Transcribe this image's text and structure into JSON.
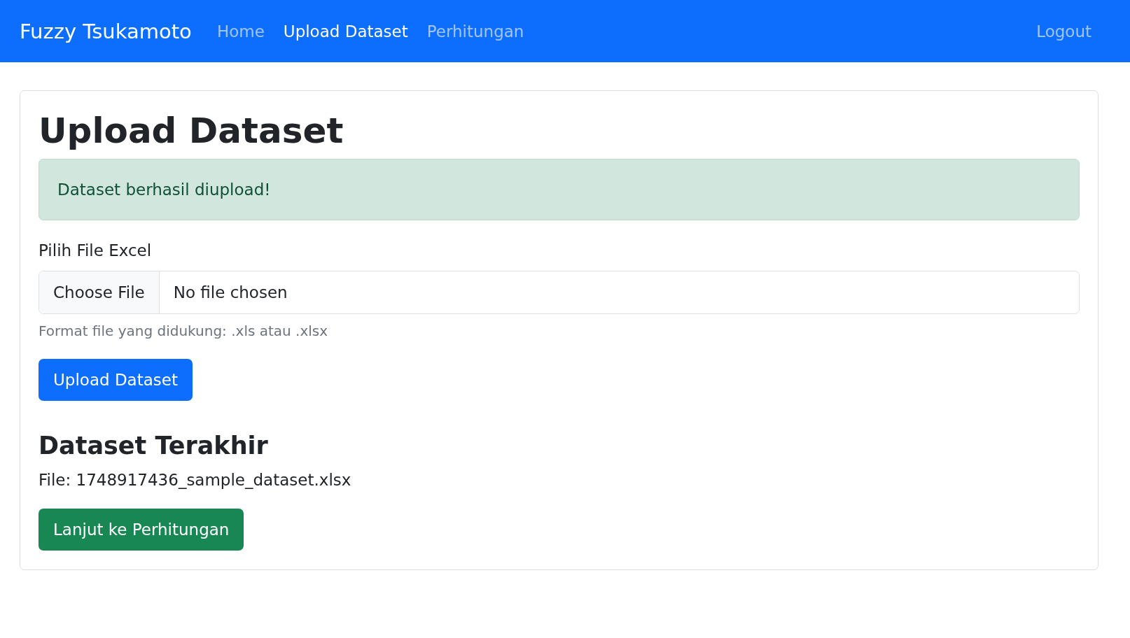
{
  "navbar": {
    "brand": "Fuzzy Tsukamoto",
    "links": [
      {
        "label": "Home",
        "selected": false
      },
      {
        "label": "Upload Dataset",
        "selected": true
      },
      {
        "label": "Perhitungan",
        "selected": false
      }
    ],
    "logout": "Logout"
  },
  "card": {
    "title": "Upload Dataset",
    "alert": {
      "kind": "success",
      "text": "Dataset berhasil diupload!"
    },
    "file_field": {
      "label": "Pilih File Excel",
      "button": "Choose File",
      "value": "No file chosen",
      "help": "Format file yang didukung: .xls atau .xlsx"
    },
    "upload_button": "Upload Dataset",
    "last_heading": "Dataset Terakhir",
    "last_file": "File: 1748917436_sample_dataset.xlsx",
    "next_button": "Lanjut ke Perhitungan"
  }
}
